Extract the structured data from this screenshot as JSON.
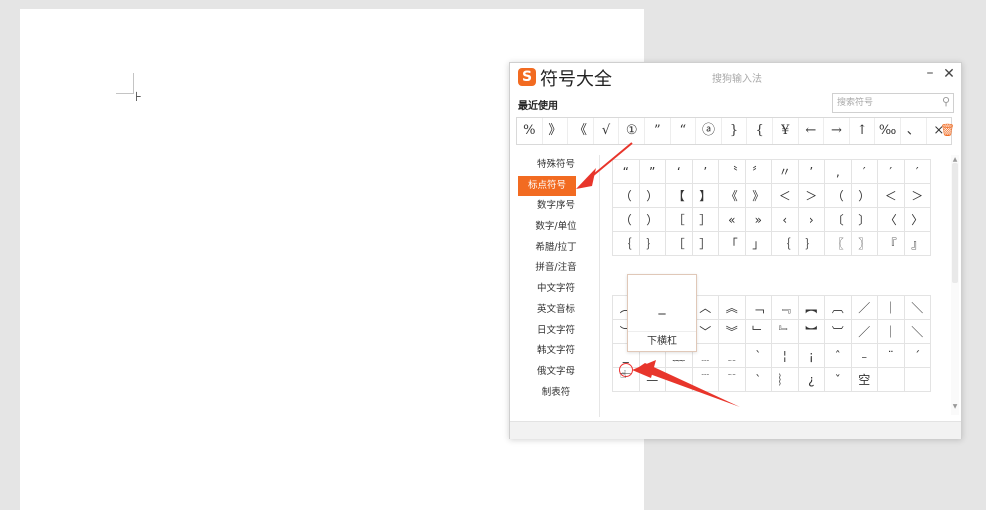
{
  "document": {
    "caret_glyph": "⊦"
  },
  "ime_window": {
    "logo_letter": "S",
    "title": "符号大全",
    "ime_name": "搜狗输入法",
    "minimize": "–",
    "close": "✕",
    "recent_label": "最近使用",
    "search_placeholder": "搜索符号",
    "search_icon": "⚲",
    "trash_icon": "🗑",
    "recent_symbols": [
      "%",
      "》",
      "《",
      "√",
      "①",
      "”",
      "“",
      "ⓐ",
      "}",
      "{",
      "¥",
      "←",
      "→",
      "↑",
      "‰",
      "、",
      "×"
    ],
    "categories": [
      "特殊符号",
      "标点符号",
      "数字序号",
      "数字/单位",
      "希腊/拉丁",
      "拼音/注音",
      "中文字符",
      "英文音标",
      "日文字符",
      "韩文字符",
      "俄文字母",
      "制表符"
    ],
    "active_category": "标点符号",
    "grid_top": [
      "“",
      "”",
      "‘",
      "’",
      "〝",
      "〞",
      "〃",
      "’",
      "‚",
      "′",
      "′",
      "′",
      "（",
      "）",
      "【",
      "】",
      "《",
      "》",
      "＜",
      "＞",
      "（",
      "）",
      "＜",
      "＞",
      "（",
      "）",
      "［",
      "］",
      "«",
      "»",
      "‹",
      "›",
      "〔",
      "〕",
      "〈",
      "〉",
      "｛",
      "｝",
      "［",
      "］",
      "「",
      "」",
      "｛",
      "｝",
      "〖",
      "〗",
      "『",
      "』"
    ],
    "grid_bottom": [
      "︵",
      "",
      "",
      "︿",
      "︽",
      "﹁",
      "﹃",
      "︻",
      "︹",
      "／",
      "｜",
      "＼",
      "︶",
      "",
      "",
      "﹀",
      "︾",
      "﹂",
      "﹄",
      "︼",
      "︺",
      "／",
      "｜",
      "＼",
      "_",
      "",
      "﹏",
      "﹍",
      "﹎",
      "ˋ",
      "¦",
      "¡",
      "ˆ",
      "﹣",
      "¨",
      "ˊ",
      "￣",
      "—",
      "",
      "﹉",
      "﹊",
      "ˋ",
      "︴",
      "¿",
      "ˇ",
      "空",
      "",
      ""
    ],
    "tooltip": {
      "symbol": "_",
      "name": "下横杠"
    },
    "cursor_icon": "☝"
  },
  "colors": {
    "accent": "#f26b21",
    "annotation": "#e8352b"
  }
}
